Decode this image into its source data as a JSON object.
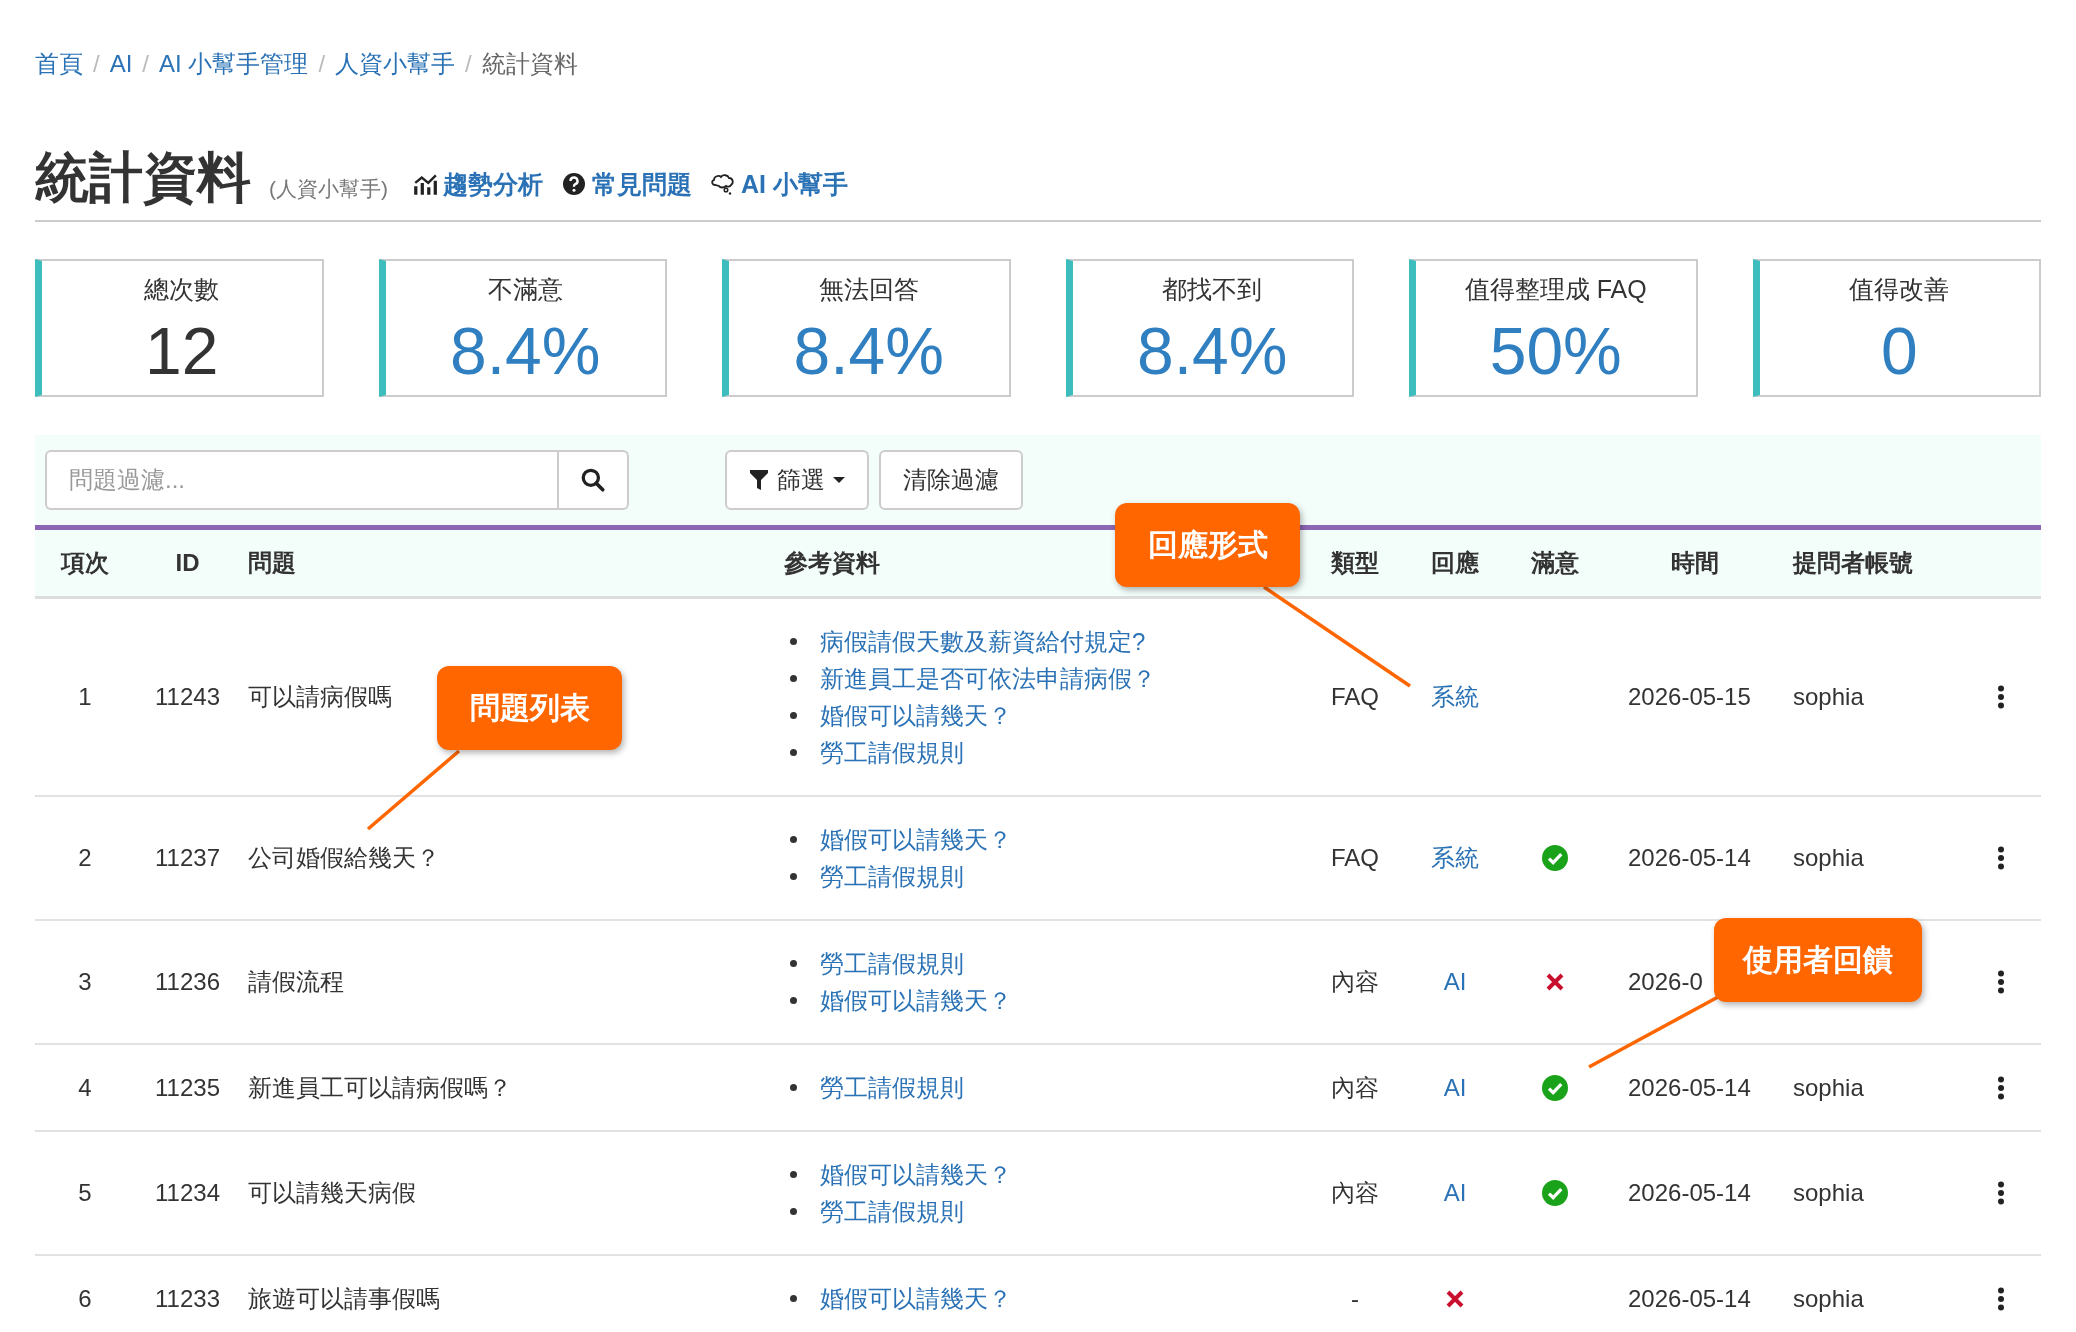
{
  "breadcrumb": [
    {
      "label": "首頁",
      "current": false,
      "separator": "/"
    },
    {
      "label": "AI",
      "current": false,
      "separator": "/"
    },
    {
      "label": "AI 小幫手管理",
      "current": false,
      "separator": "/"
    },
    {
      "label": "人資小幫手",
      "current": false,
      "separator": "/"
    },
    {
      "label": "統計資料",
      "current": true
    }
  ],
  "header": {
    "title": "統計資料",
    "subtitle": "(人資小幫手)",
    "links": [
      {
        "kind": "trend",
        "label": "趨勢分析"
      },
      {
        "kind": "faq",
        "label": "常見問題"
      },
      {
        "kind": "bot",
        "label": "AI 小幫手"
      }
    ]
  },
  "stats": [
    {
      "label": "總次數",
      "value": "12",
      "emphasis": false
    },
    {
      "label": "不滿意",
      "value": "8.4%",
      "emphasis": true
    },
    {
      "label": "無法回答",
      "value": "8.4%",
      "emphasis": true
    },
    {
      "label": "都找不到",
      "value": "8.4%",
      "emphasis": true
    },
    {
      "label": "值得整理成 FAQ",
      "value": "50%",
      "emphasis": true
    },
    {
      "label": "值得改善",
      "value": "0",
      "emphasis": true
    }
  ],
  "filter": {
    "placeholder": "問題過濾...",
    "filter_button": "篩選",
    "clear_button": "清除過濾"
  },
  "table": {
    "columns": [
      "項次",
      "ID",
      "問題",
      "參考資料",
      "類型",
      "回應",
      "滿意",
      "時間",
      "提問者帳號"
    ],
    "rows": [
      {
        "index": "1",
        "id": "11243",
        "question": "可以請病假嗎",
        "references": [
          "病假請假天數及薪資給付規定?",
          "新進員工是否可依法申請病假？",
          "婚假可以請幾天？",
          "勞工請假規則"
        ],
        "type": "FAQ",
        "response": {
          "kind": "link",
          "label": "系統"
        },
        "time": "2026-05-15",
        "account": "sophia"
      },
      {
        "index": "2",
        "id": "11237",
        "question": "公司婚假給幾天？",
        "references": [
          "婚假可以請幾天？",
          "勞工請假規則"
        ],
        "type": "FAQ",
        "response": {
          "kind": "link",
          "label": "系統"
        },
        "satisfied": true,
        "time": "2026-05-14",
        "account": "sophia"
      },
      {
        "index": "3",
        "id": "11236",
        "question": "請假流程",
        "references": [
          "勞工請假規則",
          "婚假可以請幾天？"
        ],
        "type": "內容",
        "response": {
          "kind": "link",
          "label": "AI"
        },
        "satisfied": false,
        "time": "2026-0"
      },
      {
        "index": "4",
        "id": "11235",
        "question": "新進員工可以請病假嗎？",
        "references": [
          "勞工請假規則"
        ],
        "type": "內容",
        "response": {
          "kind": "link",
          "label": "AI"
        },
        "satisfied": true,
        "time": "2026-05-14",
        "account": "sophia"
      },
      {
        "index": "5",
        "id": "11234",
        "question": "可以請幾天病假",
        "references": [
          "婚假可以請幾天？",
          "勞工請假規則"
        ],
        "type": "內容",
        "response": {
          "kind": "link",
          "label": "AI"
        },
        "satisfied": true,
        "time": "2026-05-14",
        "account": "sophia"
      },
      {
        "index": "6",
        "id": "11233",
        "question": "旅遊可以請事假嗎",
        "references": [
          "婚假可以請幾天？"
        ],
        "type": "-",
        "response": {
          "kind": "failed"
        },
        "time": "2026-05-14",
        "account": "sophia"
      }
    ]
  },
  "callouts": [
    {
      "text": "問題列表"
    },
    {
      "text": "回應形式"
    },
    {
      "text": "使用者回饋"
    }
  ]
}
